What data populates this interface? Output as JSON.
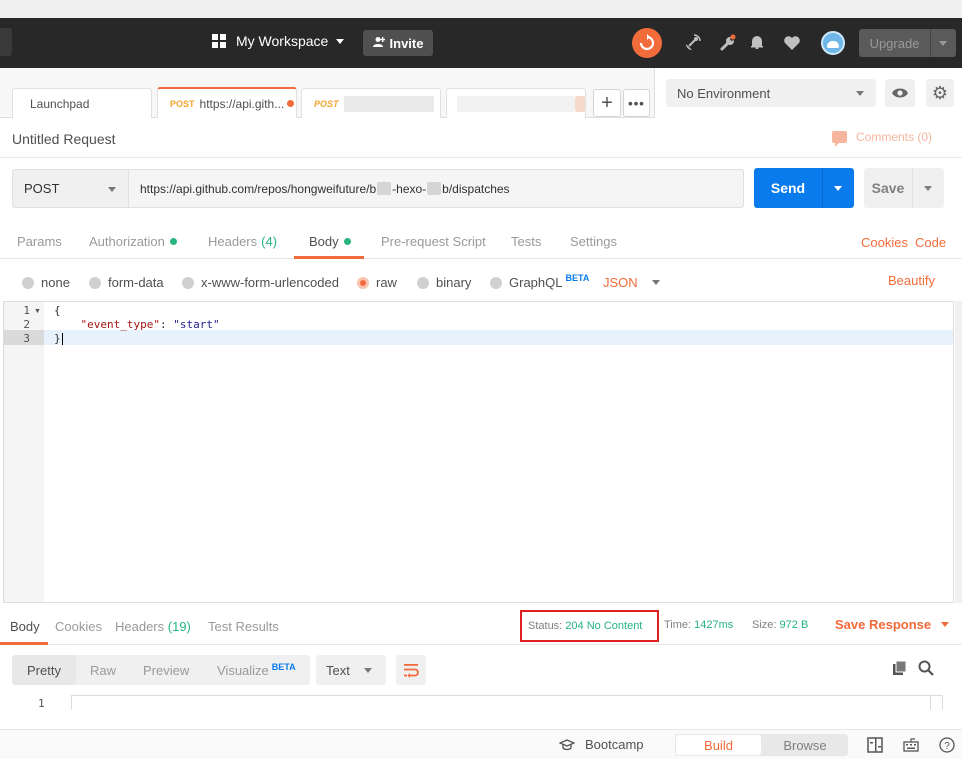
{
  "header": {
    "workspace_label": "My Workspace",
    "invite_label": "Invite",
    "upgrade_label": "Upgrade",
    "icons": [
      "sync-icon",
      "satellite-icon",
      "wrench-icon",
      "bell-icon",
      "heart-icon",
      "avatar"
    ]
  },
  "tabs": [
    {
      "label": "Launchpad"
    },
    {
      "method": "POST",
      "label": "https://api.gith...",
      "unsaved": true
    },
    {
      "method": "POST",
      "label": ""
    }
  ],
  "environment": {
    "selected": "No Environment"
  },
  "request": {
    "title": "Untitled Request",
    "comments_label": "Comments (0)",
    "method": "POST",
    "url_part1": "https://api.github.com/repos/hongweifuture/b",
    "url_part2": "-hexo-",
    "url_part3": "b/dispatches",
    "send_label": "Send",
    "save_label": "Save"
  },
  "request_tabs": {
    "params": "Params",
    "authorization": "Authorization",
    "headers": "Headers",
    "headers_count": "(4)",
    "body": "Body",
    "prerequest": "Pre-request Script",
    "tests": "Tests",
    "settings": "Settings",
    "cookies": "Cookies",
    "code": "Code"
  },
  "body_options": {
    "none": "none",
    "form_data": "form-data",
    "urlencoded": "x-www-form-urlencoded",
    "raw": "raw",
    "binary": "binary",
    "graphql": "GraphQL",
    "beta": "BETA",
    "format": "JSON",
    "beautify": "Beautify",
    "selected": "raw"
  },
  "editor": {
    "line_numbers": [
      "1",
      "2",
      "3"
    ],
    "line1": "{",
    "line2_key": "\"event_type\"",
    "line2_sep": ": ",
    "line2_value": "\"start\"",
    "line3": "}"
  },
  "response": {
    "tabs": {
      "body": "Body",
      "cookies": "Cookies",
      "headers": "Headers",
      "headers_count": "(19)",
      "test_results": "Test Results"
    },
    "status_label": "Status:",
    "status_value": "204 No Content",
    "time_label": "Time:",
    "time_value": "1427ms",
    "size_label": "Size:",
    "size_value": "972 B",
    "save_response": "Save Response",
    "views": {
      "pretty": "Pretty",
      "raw": "Raw",
      "preview": "Preview",
      "visualize": "Visualize",
      "beta": "BETA"
    },
    "format": "Text",
    "line_number": "1"
  },
  "footer": {
    "bootcamp": "Bootcamp",
    "build": "Build",
    "browse": "Browse"
  },
  "colors": {
    "accent": "#f26b3a",
    "primary": "#097bed",
    "success": "#26b47f",
    "header_bg": "#282828",
    "highlight_box": "#e02020"
  }
}
